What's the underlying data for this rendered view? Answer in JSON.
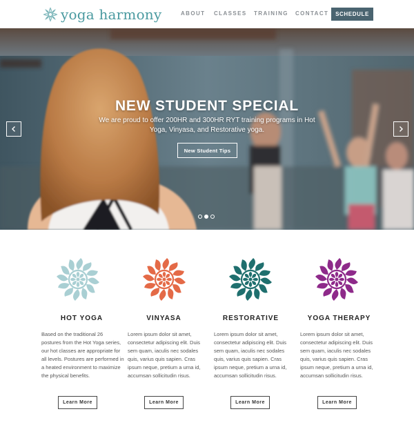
{
  "brand": {
    "yoga": "yoga",
    "harmony": "harmony",
    "color": "#4a9aa0"
  },
  "nav": {
    "items": [
      {
        "label": "ABOUT"
      },
      {
        "label": "CLASSES"
      },
      {
        "label": "TRAINING"
      },
      {
        "label": "CONTACT"
      }
    ],
    "schedule_label": "SCHEDULE",
    "schedule_color": "#4a6470"
  },
  "hero": {
    "title": "NEW STUDENT SPECIAL",
    "subtitle": "We are proud to offer 200HR and 300HR RYT training programs in Hot Yoga, Vinyasa, and Restorative yoga.",
    "button_label": "New Student Tips",
    "prev_icon": "chevron-left-icon",
    "next_icon": "chevron-right-icon",
    "slides_count": 3,
    "active_slide": 2
  },
  "classes": [
    {
      "title": "HOT YOGA",
      "color": "#a9cfd3",
      "body": "Based on the traditional 26 postures from the Hot Yoga series, our hot classes are appropriate for all levels. Postures are performed in a heated environment to maximize the physical benefits.",
      "button_label": "Learn More"
    },
    {
      "title": "VINYASA",
      "color": "#e46a47",
      "body": "Lorem ipsum dolor sit amet, consectetur adipiscing elit. Duis sem quam, iaculis nec sodales quis, varius quis sapien. Cras ipsum neque, pretium a urna id, accumsan sollicitudin risus.",
      "button_label": "Learn More"
    },
    {
      "title": "RESTORATIVE",
      "color": "#1f6f6e",
      "body": "Lorem ipsum dolor sit amet, consectetur adipiscing elit. Duis sem quam, iaculis nec sodales quis, varius quis sapien. Cras ipsum neque, pretium a urna id, accumsan sollicitudin risus.",
      "button_label": "Learn More"
    },
    {
      "title": "YOGA THERAPY",
      "color": "#8e2a8a",
      "body": "Lorem ipsum dolor sit amet, consectetur adipiscing elit. Duis sem quam, iaculis nec sodales quis, varius quis sapien. Cras ipsum neque, pretium a urna id, accumsan sollicitudin risus.",
      "button_label": "Learn More"
    }
  ]
}
